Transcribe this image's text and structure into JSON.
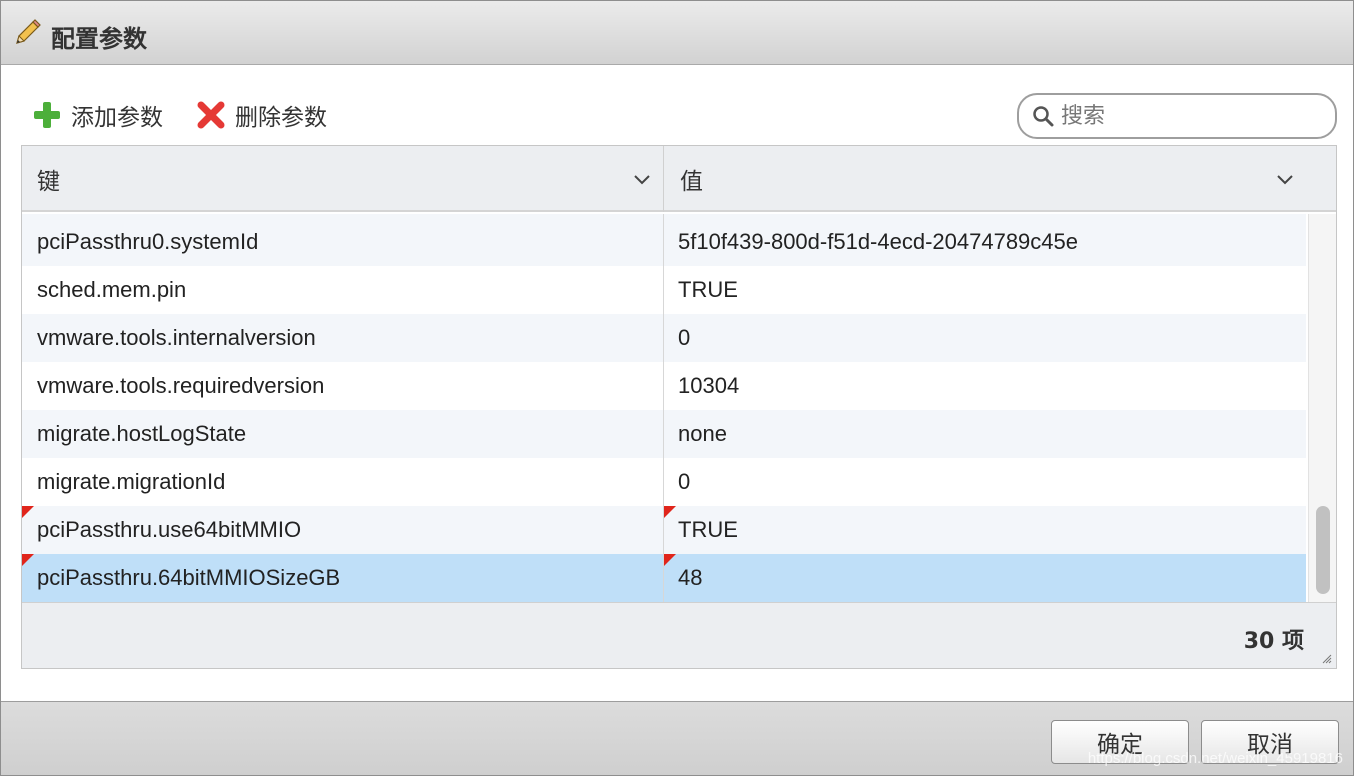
{
  "dialog": {
    "title": "配置参数"
  },
  "toolbar": {
    "add_label": "添加参数",
    "delete_label": "删除参数"
  },
  "search": {
    "placeholder": "搜索",
    "value": ""
  },
  "table": {
    "columns": [
      "键",
      "值"
    ],
    "rows": [
      {
        "key": "pciPassthru0.systemId",
        "value": "5f10f439-800d-f51d-4ecd-20474789c45e",
        "flagged": false,
        "selected": false
      },
      {
        "key": "sched.mem.pin",
        "value": "TRUE",
        "flagged": false,
        "selected": false
      },
      {
        "key": "vmware.tools.internalversion",
        "value": "0",
        "flagged": false,
        "selected": false
      },
      {
        "key": "vmware.tools.requiredversion",
        "value": "10304",
        "flagged": false,
        "selected": false
      },
      {
        "key": "migrate.hostLogState",
        "value": "none",
        "flagged": false,
        "selected": false
      },
      {
        "key": "migrate.migrationId",
        "value": "0",
        "flagged": false,
        "selected": false
      },
      {
        "key": "pciPassthru.use64bitMMIO",
        "value": "TRUE",
        "flagged": true,
        "selected": false
      },
      {
        "key": "pciPassthru.64bitMMIOSizeGB",
        "value": "48",
        "flagged": true,
        "selected": true
      }
    ],
    "count_label": "30 项"
  },
  "buttons": {
    "ok": "确定",
    "cancel": "取消"
  },
  "watermark": "https://blog.csdn.net/weixin_45919816",
  "colors": {
    "selected_row": "#bfdff8",
    "flag": "#e0251b",
    "add_icon": "#4caf3a",
    "delete_icon": "#e53935"
  }
}
